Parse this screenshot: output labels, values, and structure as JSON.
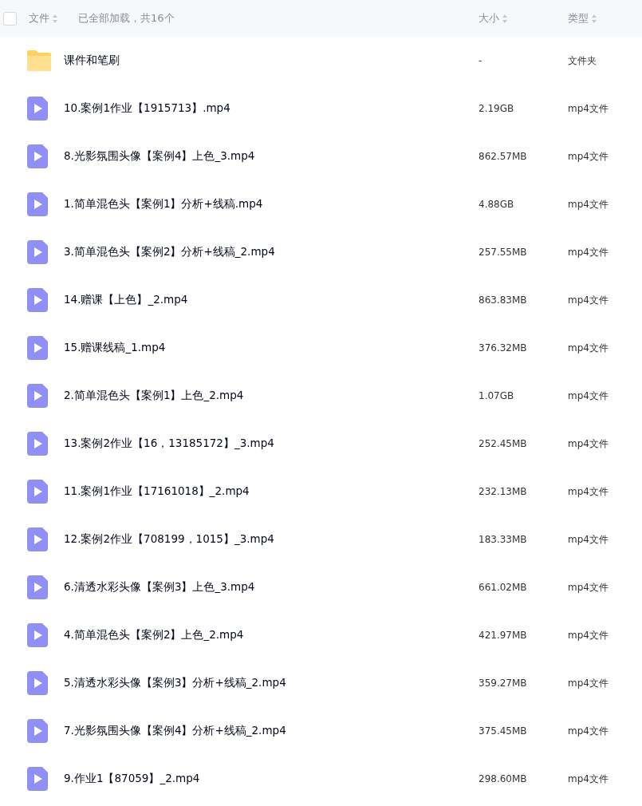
{
  "header": {
    "checked": false,
    "name_column": "文件",
    "status": "已全部加载，共16个",
    "size_column": "大小",
    "type_column": "类型"
  },
  "files": [
    {
      "kind": "folder",
      "name": "课件和笔刷",
      "size": "-",
      "type": "文件夹"
    },
    {
      "kind": "video",
      "name": "10.案例1作业【1915713】.mp4",
      "size": "2.19GB",
      "type": "mp4文件"
    },
    {
      "kind": "video",
      "name": "8.光影氛围头像【案例4】上色_3.mp4",
      "size": "862.57MB",
      "type": "mp4文件"
    },
    {
      "kind": "video",
      "name": "1.简单混色头【案例1】分析+线稿.mp4",
      "size": "4.88GB",
      "type": "mp4文件"
    },
    {
      "kind": "video",
      "name": "3.简单混色头【案例2】分析+线稿_2.mp4",
      "size": "257.55MB",
      "type": "mp4文件"
    },
    {
      "kind": "video",
      "name": "14.赠课【上色】_2.mp4",
      "size": "863.83MB",
      "type": "mp4文件"
    },
    {
      "kind": "video",
      "name": "15.赠课线稿_1.mp4",
      "size": "376.32MB",
      "type": "mp4文件"
    },
    {
      "kind": "video",
      "name": "2.简单混色头【案例1】上色_2.mp4",
      "size": "1.07GB",
      "type": "mp4文件"
    },
    {
      "kind": "video",
      "name": "13.案例2作业【16，13185172】_3.mp4",
      "size": "252.45MB",
      "type": "mp4文件"
    },
    {
      "kind": "video",
      "name": "11.案例1作业【17161018】_2.mp4",
      "size": "232.13MB",
      "type": "mp4文件"
    },
    {
      "kind": "video",
      "name": "12.案例2作业【708199，1015】_3.mp4",
      "size": "183.33MB",
      "type": "mp4文件"
    },
    {
      "kind": "video",
      "name": "6.清透水彩头像【案例3】上色_3.mp4",
      "size": "661.02MB",
      "type": "mp4文件"
    },
    {
      "kind": "video",
      "name": "4.简单混色头【案例2】上色_2.mp4",
      "size": "421.97MB",
      "type": "mp4文件"
    },
    {
      "kind": "video",
      "name": "5.清透水彩头像【案例3】分析+线稿_2.mp4",
      "size": "359.27MB",
      "type": "mp4文件"
    },
    {
      "kind": "video",
      "name": "7.光影氛围头像【案例4】分析+线稿_2.mp4",
      "size": "375.45MB",
      "type": "mp4文件"
    },
    {
      "kind": "video",
      "name": "9.作业1【87059】_2.mp4",
      "size": "298.60MB",
      "type": "mp4文件"
    }
  ]
}
